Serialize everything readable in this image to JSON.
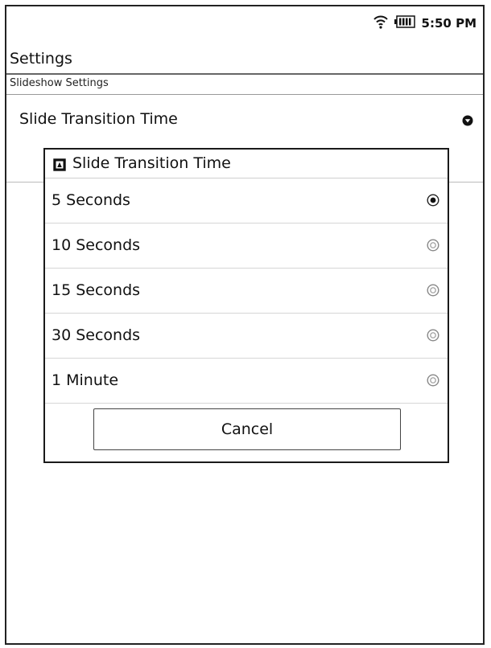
{
  "status_bar": {
    "time": "5:50 PM",
    "icons": [
      "wifi-icon",
      "battery-icon"
    ]
  },
  "app": {
    "title": "Settings"
  },
  "section": {
    "header": "Slideshow Settings"
  },
  "setting": {
    "label": "Slide Transition Time",
    "icon": "spinner-down-icon"
  },
  "dialog": {
    "title": "Slide Transition Time",
    "title_icon": "dialog-title-icon",
    "options": [
      {
        "label": "5 Seconds",
        "selected": true
      },
      {
        "label": "10 Seconds",
        "selected": false
      },
      {
        "label": "15 Seconds",
        "selected": false
      },
      {
        "label": "30 Seconds",
        "selected": false
      },
      {
        "label": "1 Minute",
        "selected": false
      }
    ],
    "cancel_label": "Cancel"
  }
}
